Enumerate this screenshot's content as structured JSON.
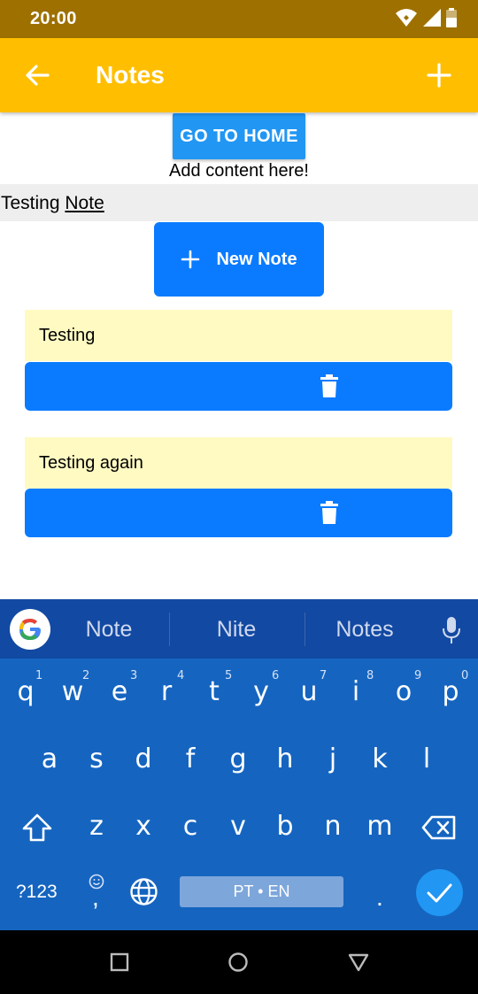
{
  "status_bar": {
    "time": "20:00"
  },
  "app_bar": {
    "title": "Notes"
  },
  "content": {
    "home_button": "GO TO HOME",
    "add_content": "Add content here!",
    "note_input": {
      "word1": "Testing",
      "word2": "Note"
    },
    "new_note_button": "New Note",
    "notes": [
      {
        "text": "Testing"
      },
      {
        "text": "Testing again"
      }
    ]
  },
  "keyboard": {
    "suggestions": [
      "Note",
      "Nite",
      "Notes"
    ],
    "row1": [
      "q",
      "w",
      "e",
      "r",
      "t",
      "y",
      "u",
      "i",
      "o",
      "p"
    ],
    "row1_hints": [
      "1",
      "2",
      "3",
      "4",
      "5",
      "6",
      "7",
      "8",
      "9",
      "0"
    ],
    "row2": [
      "a",
      "s",
      "d",
      "f",
      "g",
      "h",
      "j",
      "k",
      "l"
    ],
    "row3": [
      "z",
      "x",
      "c",
      "v",
      "b",
      "n",
      "m"
    ],
    "symbols_key": "?123",
    "comma": ",",
    "period": ".",
    "space_label": "PT • EN"
  },
  "colors": {
    "status_bar": "#9E7000",
    "app_bar": "#FFBF00",
    "home_button": "#2196F3",
    "primary_blue": "#0A7BFF",
    "note_card": "#FFFAC2",
    "keyboard": "#1565C0",
    "suggest_bar": "#1249A2"
  }
}
